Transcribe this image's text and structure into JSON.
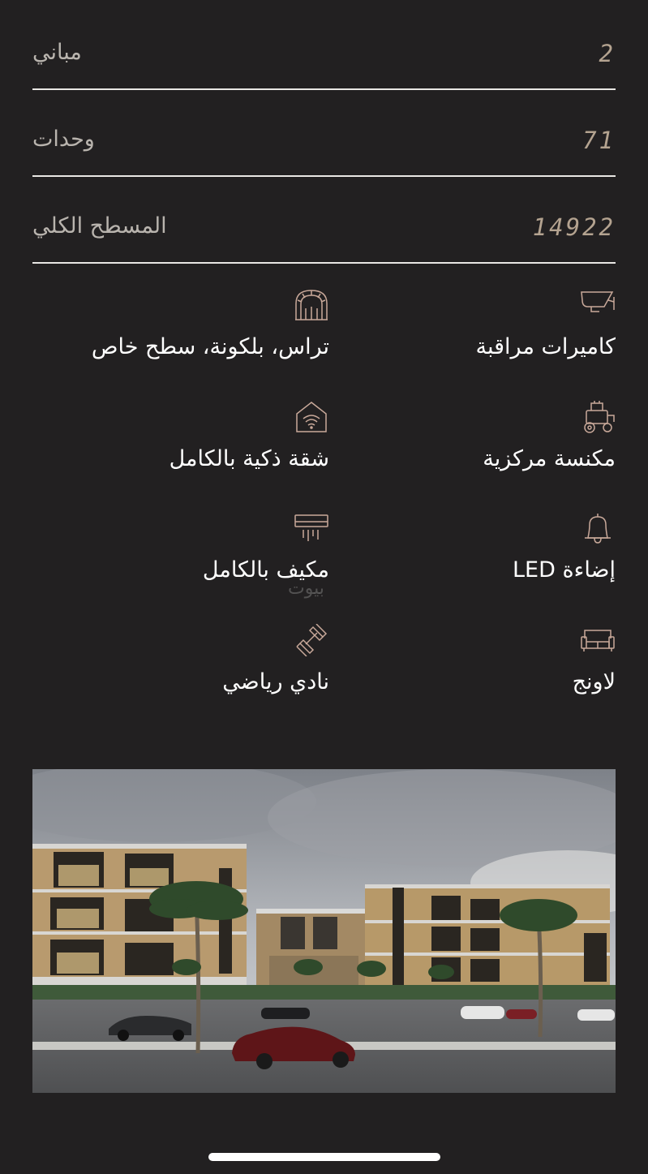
{
  "stats": [
    {
      "label": "مباني",
      "value": "2"
    },
    {
      "label": "وحدات",
      "value": "71"
    },
    {
      "label": "المسطح الكلي",
      "value": "14922"
    }
  ],
  "features": {
    "surveillance": {
      "label": "كاميرات مراقبة",
      "icon": "security-camera-icon"
    },
    "terrace": {
      "label": "تراس، بلكونة، سطح خاص",
      "icon": "arched-window-icon"
    },
    "central_vacuum": {
      "label": "مكنسة مركزية",
      "icon": "vacuum-machine-icon"
    },
    "smart_home": {
      "label": "شقة ذكية بالكامل",
      "icon": "smart-home-wifi-icon"
    },
    "led_lighting": {
      "label": "إضاءة LED",
      "icon": "bell-lamp-icon"
    },
    "air_conditioning": {
      "label": "مكيف بالكامل",
      "icon": "air-conditioner-icon"
    },
    "lounge": {
      "label": "لاونج",
      "icon": "sofa-icon"
    },
    "gym": {
      "label": "نادي رياضي",
      "icon": "dumbbell-icon"
    }
  },
  "watermark": "بيوت",
  "colors": {
    "background": "#222021",
    "stat_value": "#b4a390",
    "stat_label": "#b9b4ae",
    "divider": "#e9e7e4",
    "icon_stroke": "#c9a99a"
  }
}
